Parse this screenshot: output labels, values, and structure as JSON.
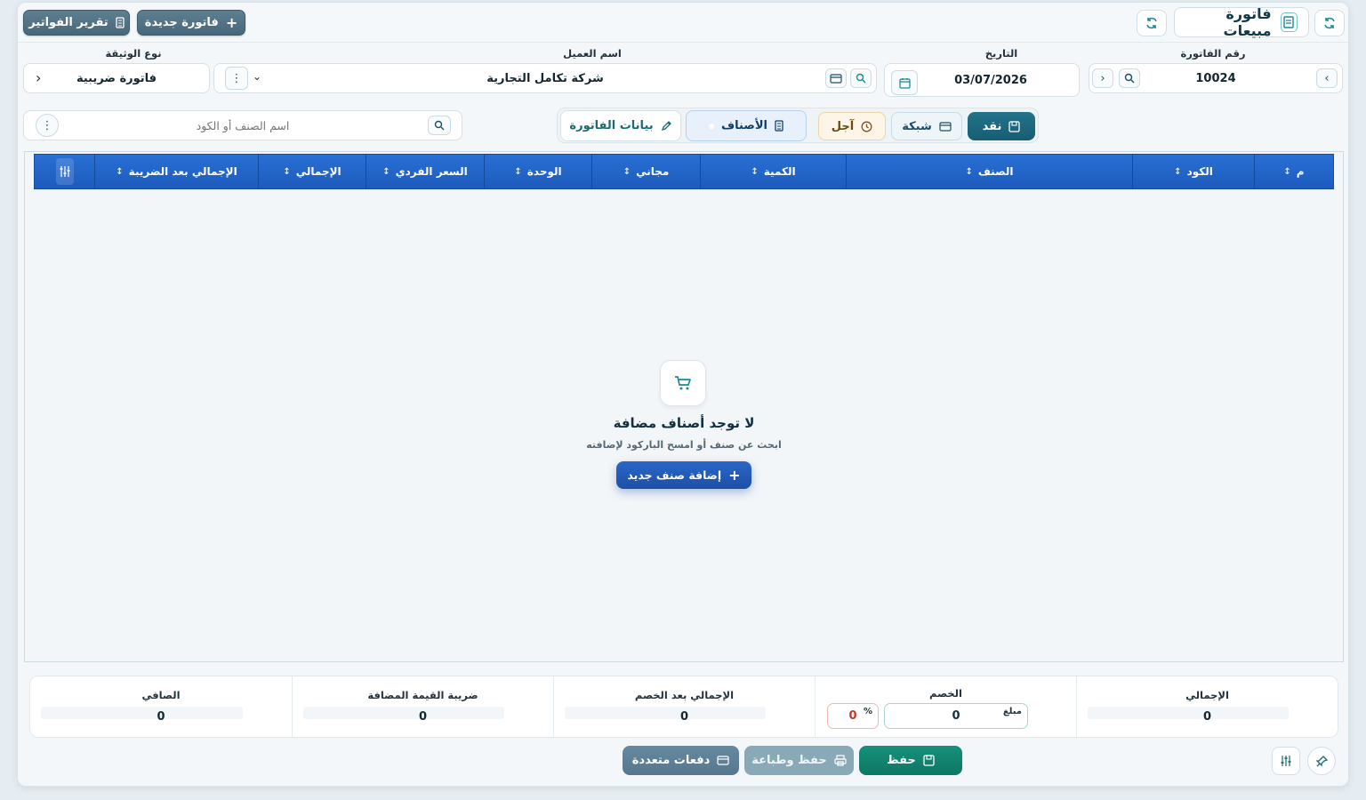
{
  "header": {
    "title": "فاتورة مبيعات",
    "new_invoice_label": "فاتورة جديدة",
    "invoice_report_label": "تقرير الفواتير"
  },
  "fields": {
    "invoice_number": {
      "label": "رقم الفاتورة",
      "value": "10024"
    },
    "date": {
      "label": "التاريخ",
      "value": "03/07/2026"
    },
    "customer": {
      "label": "اسم العميل",
      "value": "شركة تكامل التجارية"
    },
    "doc_type": {
      "label": "نوع الوثيقة",
      "value": "فاتورة ضريبية"
    }
  },
  "payment_tabs": {
    "cash": "نقد",
    "network": "شبكة",
    "deferred": "آجل"
  },
  "view_tabs": {
    "items": "الأصناف",
    "invoice_data": "بيانات الفاتورة"
  },
  "search": {
    "placeholder": "اسم الصنف أو الكود"
  },
  "table": {
    "columns": [
      "م",
      "الكود",
      "الصنف",
      "الكمية",
      "مجاني",
      "الوحدة",
      "السعر الفردي",
      "الإجمالي",
      "الإجمالي بعد الضريبة"
    ]
  },
  "empty_state": {
    "title": "لا توجد أصناف مضافة",
    "subtitle": "ابحث عن صنف أو امسح الباركود لإضافته",
    "add_button": "إضافة صنف جديد"
  },
  "totals": {
    "total": {
      "label": "الإجمالي",
      "value": "0"
    },
    "discount": {
      "label": "الخصم",
      "amount_label": "مبلغ",
      "amount_value": "0",
      "percent_symbol": "%",
      "percent_value": "0"
    },
    "after_discount": {
      "label": "الإجمالي بعد الخصم",
      "value": "0"
    },
    "vat": {
      "label": "ضريبة القيمة المضافة",
      "value": "0"
    },
    "net": {
      "label": "الصافي",
      "value": "0"
    }
  },
  "footer": {
    "save": "حفظ",
    "save_print": "حفظ وطباعة",
    "multi_payments": "دفعات متعددة"
  }
}
